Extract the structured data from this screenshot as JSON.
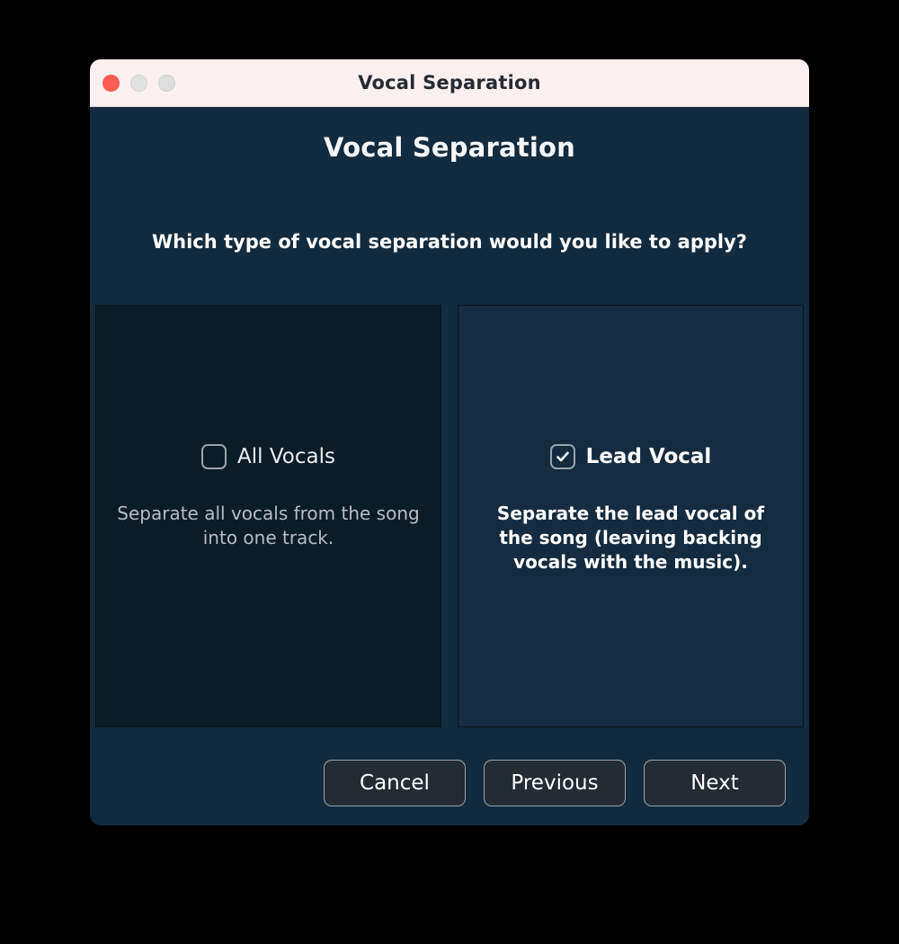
{
  "window": {
    "title": "Vocal Separation",
    "traffic_lights": [
      {
        "name": "close-button",
        "color": "#fc5b50"
      },
      {
        "name": "minimize-button",
        "color": "#e2e2e2"
      },
      {
        "name": "zoom-button",
        "color": "#dedede"
      }
    ]
  },
  "dialog": {
    "heading": "Vocal Separation",
    "prompt": "Which type of vocal separation would you like to apply?",
    "options": [
      {
        "id": "all-vocals",
        "label": "All Vocals",
        "checked": false,
        "description": "Separate all vocals from the song into one track."
      },
      {
        "id": "lead-vocal",
        "label": "Lead Vocal",
        "checked": true,
        "description": "Separate the lead vocal of the song (leaving backing vocals with the music)."
      }
    ],
    "buttons": {
      "cancel": "Cancel",
      "previous": "Previous",
      "next": "Next"
    }
  },
  "colors": {
    "dialog_background": "#132b3e",
    "card_unselected": "#0a1c28",
    "card_selected": "#152c40",
    "titlebar_background": "#fbf0f0",
    "title_text": "#262b33",
    "body_text": "#ffffff",
    "muted_text": "#b5bdc4",
    "button_background": "#242b33",
    "button_border": "#9aa4ac"
  }
}
